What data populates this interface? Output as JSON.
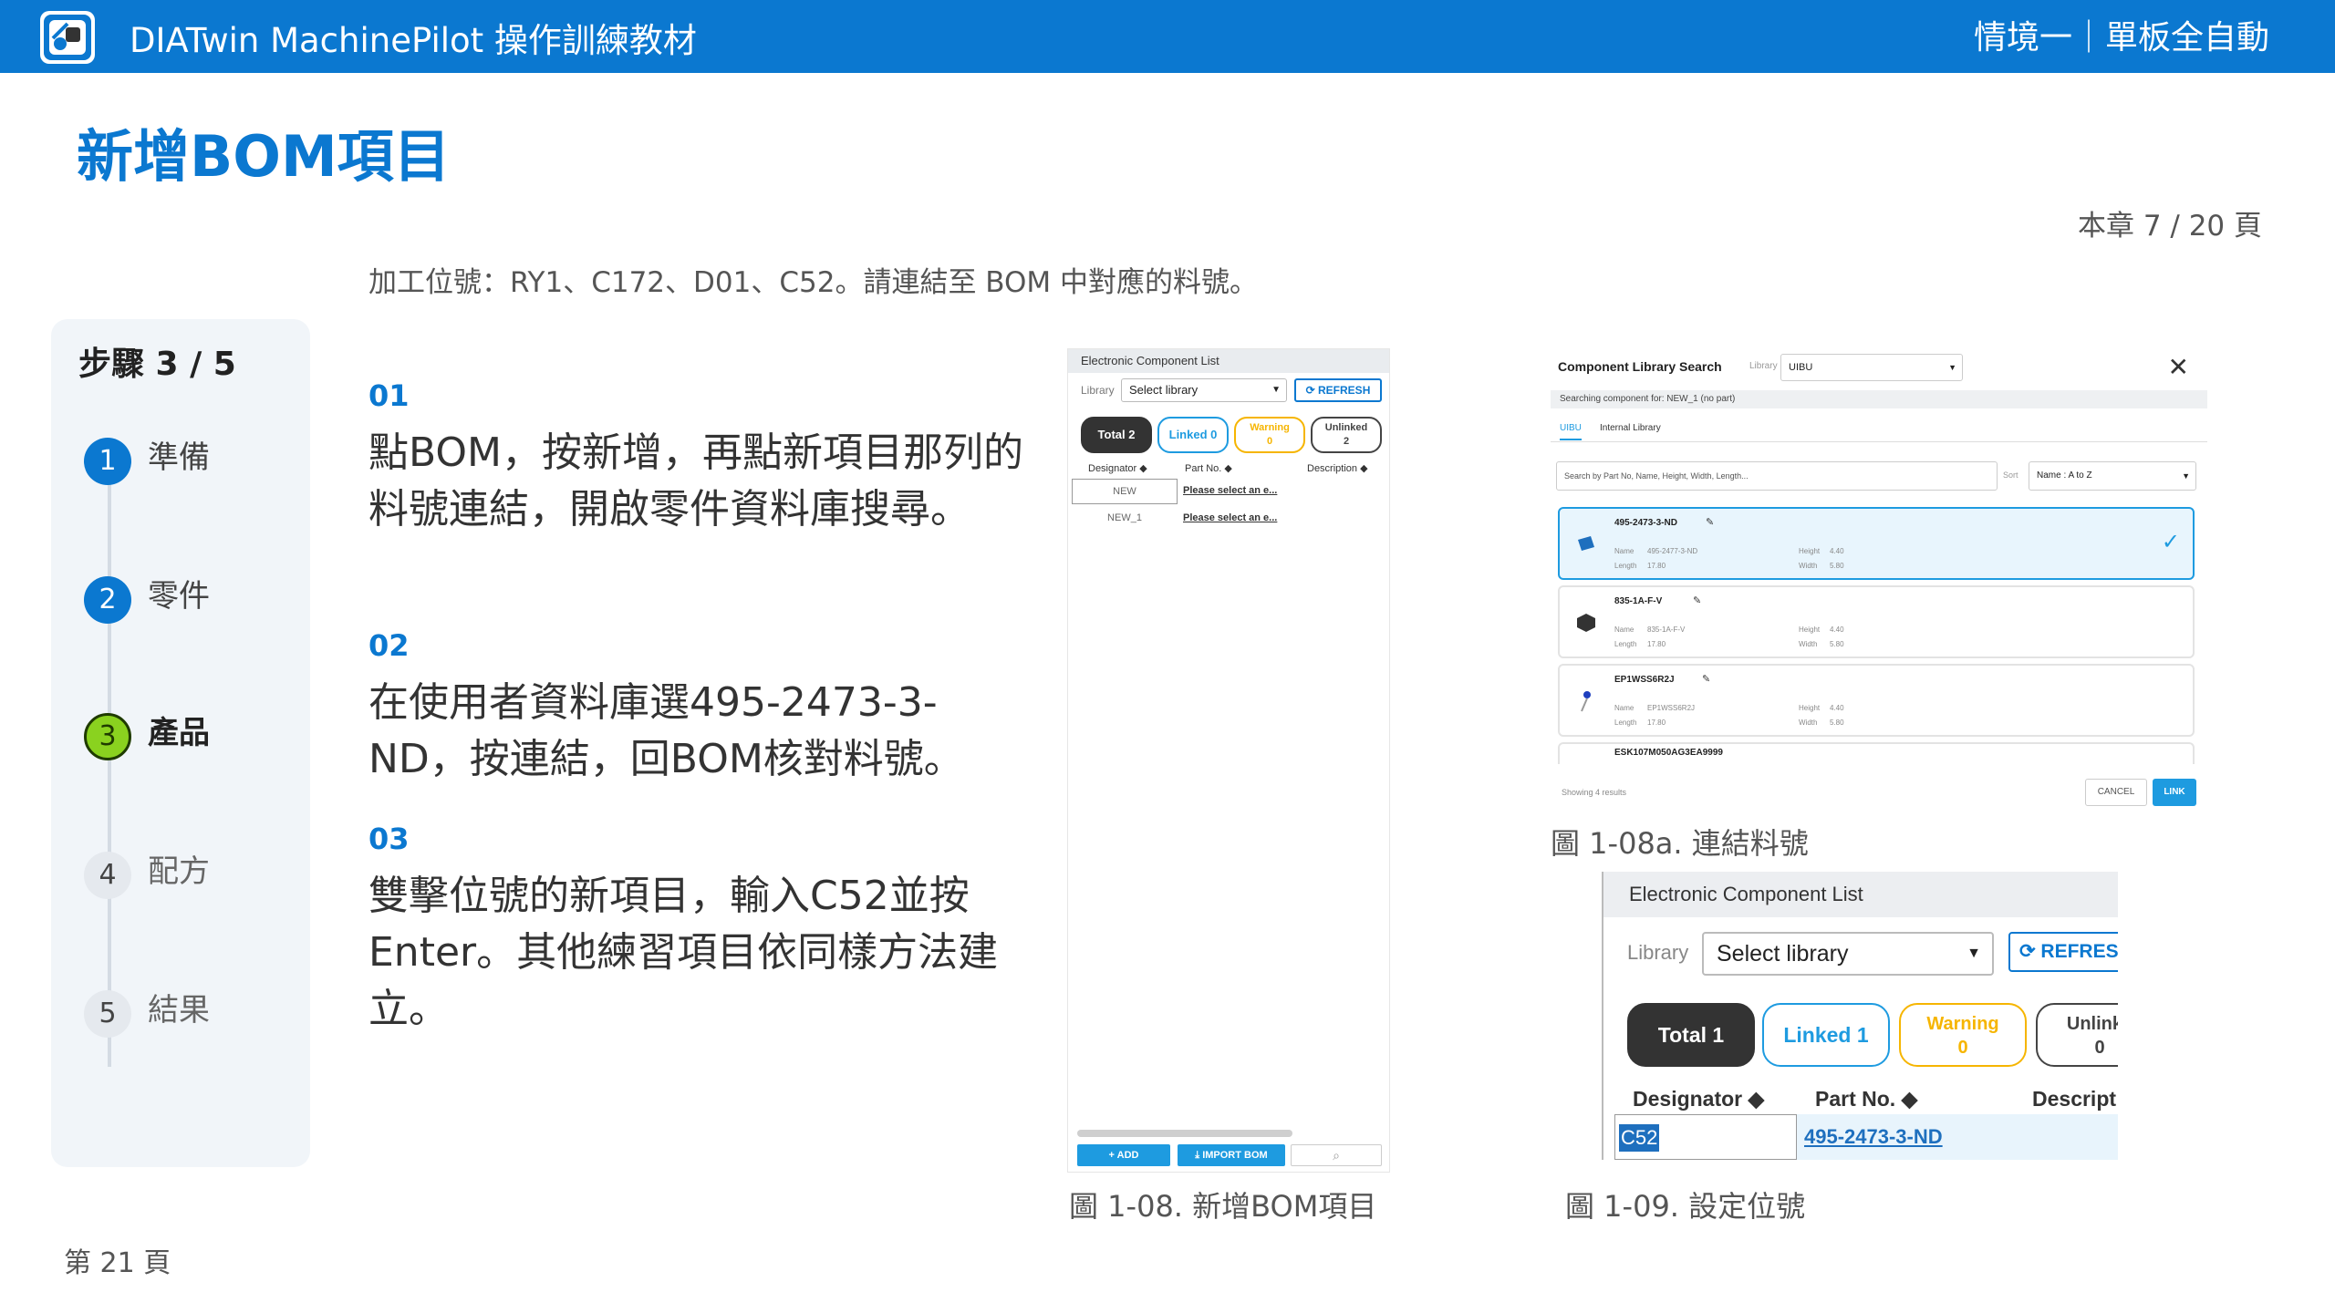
{
  "header": {
    "app_title": "DIATwin MachinePilot 操作訓練教材",
    "scenario": "情境一｜單板全自動"
  },
  "page_title": "新增BOM項目",
  "chapter_position": "本章 7 / 20 頁",
  "instruction": "加工位號：RY1、C172、D01、C52。請連結至 BOM 中對應的料號。",
  "stepper": {
    "title": "步驟 3 / 5",
    "steps": [
      {
        "num": "1",
        "label": "準備",
        "state": "done"
      },
      {
        "num": "2",
        "label": "零件",
        "state": "done"
      },
      {
        "num": "3",
        "label": "產品",
        "state": "current"
      },
      {
        "num": "4",
        "label": "配方",
        "state": "todo"
      },
      {
        "num": "5",
        "label": "結果",
        "state": "todo"
      }
    ]
  },
  "blocks": [
    {
      "num": "01",
      "text": "點BOM，按新增，再點新項目那列的料號連結，開啟零件資料庫搜尋。"
    },
    {
      "num": "02",
      "text": "在使用者資料庫選495-2473-3-ND，按連結，回BOM核對料號。"
    },
    {
      "num": "03",
      "text": "雙擊位號的新項目，輸入C52並按Enter。其他練習項目依同樣方法建立。"
    }
  ],
  "fig_bom": {
    "header": "Electronic Component List",
    "library_label": "Library",
    "library_value": "Select library",
    "refresh": "⟳ REFRESH",
    "total": "Total 2",
    "linked": "Linked 0",
    "warning_label": "Warning",
    "warning_count": "0",
    "unlinked_label": "Unlinked",
    "unlinked_count": "2",
    "columns": [
      "Designator ◆",
      "Part No. ◆",
      "Description ◆"
    ],
    "rows": [
      {
        "designator": "NEW",
        "part": "Please select an e..."
      },
      {
        "designator": "NEW_1",
        "part": "Please select an e..."
      }
    ],
    "add": "+ ADD",
    "import": "⤓ IMPORT BOM",
    "caption": "圖 1-08. 新增BOM項目"
  },
  "fig_search": {
    "title": "Component Library Search",
    "library_label": "Library",
    "library_value": "UIBU",
    "info": "Searching component for: NEW_1 (no part)",
    "tabs": [
      "UIBU",
      "Internal Library"
    ],
    "search_placeholder": "Search by Part No, Name, Height, Width, Length...",
    "sort_label": "Sort",
    "sort_value": "Name : A to Z",
    "field_labels": {
      "name": "Name",
      "length": "Length",
      "height": "Height",
      "width": "Width"
    },
    "cards": [
      {
        "part": "495-2473-3-ND",
        "name": "495-2477-3-ND",
        "length": "17.80",
        "height": "4.40",
        "width": "5.80",
        "selected": true
      },
      {
        "part": "835-1A-F-V",
        "name": "835-1A-F-V",
        "length": "17.80",
        "height": "4.40",
        "width": "5.80",
        "selected": false
      },
      {
        "part": "EP1WSS6R2J",
        "name": "EP1WSS6R2J",
        "length": "17.80",
        "height": "4.40",
        "width": "5.80",
        "selected": false
      }
    ],
    "partial_card": "ESK107M050AG3EA9999",
    "results": "Showing 4 results",
    "cancel": "CANCEL",
    "link": "LINK",
    "caption": "圖 1-08a. 連結料號"
  },
  "fig_designator": {
    "header": "Electronic Component List",
    "library_label": "Library",
    "library_value": "Select library",
    "refresh": "⟳ REFRES",
    "total": "Total 1",
    "linked": "Linked 1",
    "warning_label": "Warning",
    "warning_count": "0",
    "unlinked_label": "Unlinke",
    "unlinked_count": "0",
    "columns": [
      "Designator ◆",
      "Part No. ◆",
      "Descript"
    ],
    "designator_value": "C52",
    "part_value": "495-2473-3-ND",
    "caption": "圖 1-09. 設定位號"
  },
  "page_number": "第 21 頁",
  "colors": {
    "brand": "#0b78d0",
    "current_step": "#8ad21f",
    "link_blue": "#1e9be0",
    "warning": "#f6b500"
  }
}
